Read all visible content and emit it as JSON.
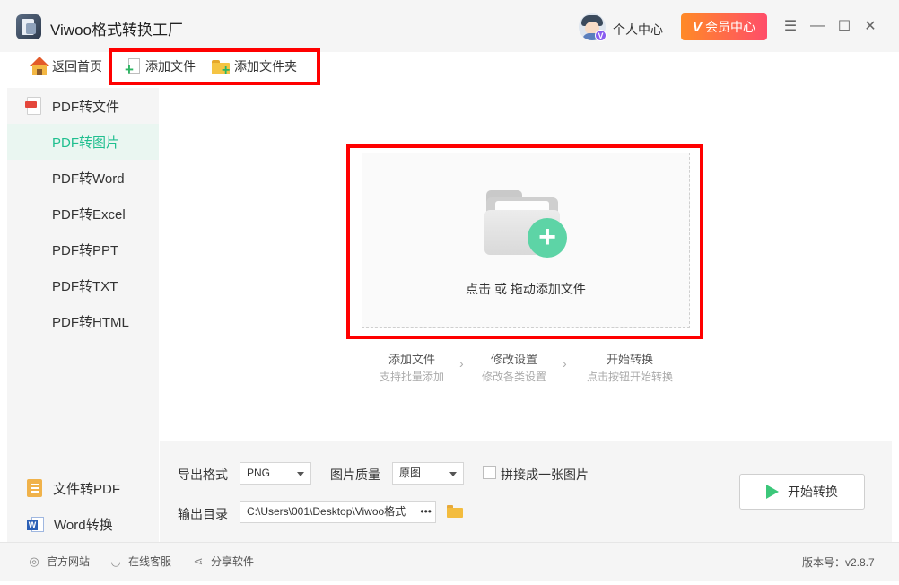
{
  "app": {
    "title": "Viwoo格式转换工厂"
  },
  "header": {
    "user_center": "个人中心",
    "vip_badge": "V",
    "vip_button": "会员中心",
    "vip_gradient": [
      "#ff8a26",
      "#ff4d6a"
    ]
  },
  "toolbar": {
    "home": "返回首页",
    "add_file": "添加文件",
    "add_folder": "添加文件夹"
  },
  "sidebar": {
    "group_pdf": "PDF转文件",
    "items": [
      "PDF转图片",
      "PDF转Word",
      "PDF转Excel",
      "PDF转PPT",
      "PDF转TXT",
      "PDF转HTML"
    ],
    "active_index": 0,
    "group_file_to_pdf": "文件转PDF",
    "group_word": "Word转换"
  },
  "dropzone": {
    "text": "点击 或 拖动添加文件"
  },
  "steps": [
    {
      "title": "添加文件",
      "sub": "支持批量添加"
    },
    {
      "title": "修改设置",
      "sub": "修改各类设置"
    },
    {
      "title": "开始转换",
      "sub": "点击按钮开始转换"
    }
  ],
  "settings": {
    "format_label": "导出格式",
    "format_value": "PNG",
    "quality_label": "图片质量",
    "quality_value": "原图",
    "merge_label": "拼接成一张图片",
    "merge_checked": false,
    "output_label": "输出目录",
    "output_path": "C:\\Users\\001\\Desktop\\Viwoo格式",
    "output_path_more": "•••"
  },
  "actions": {
    "start": "开始转换"
  },
  "footer": {
    "website": "官方网站",
    "support": "在线客服",
    "share": "分享软件",
    "version": "版本号：v2.8.7"
  },
  "colors": {
    "accent": "#1fbf8f",
    "highlight": "#ff0000",
    "plus_green": "#5dd4a6"
  }
}
